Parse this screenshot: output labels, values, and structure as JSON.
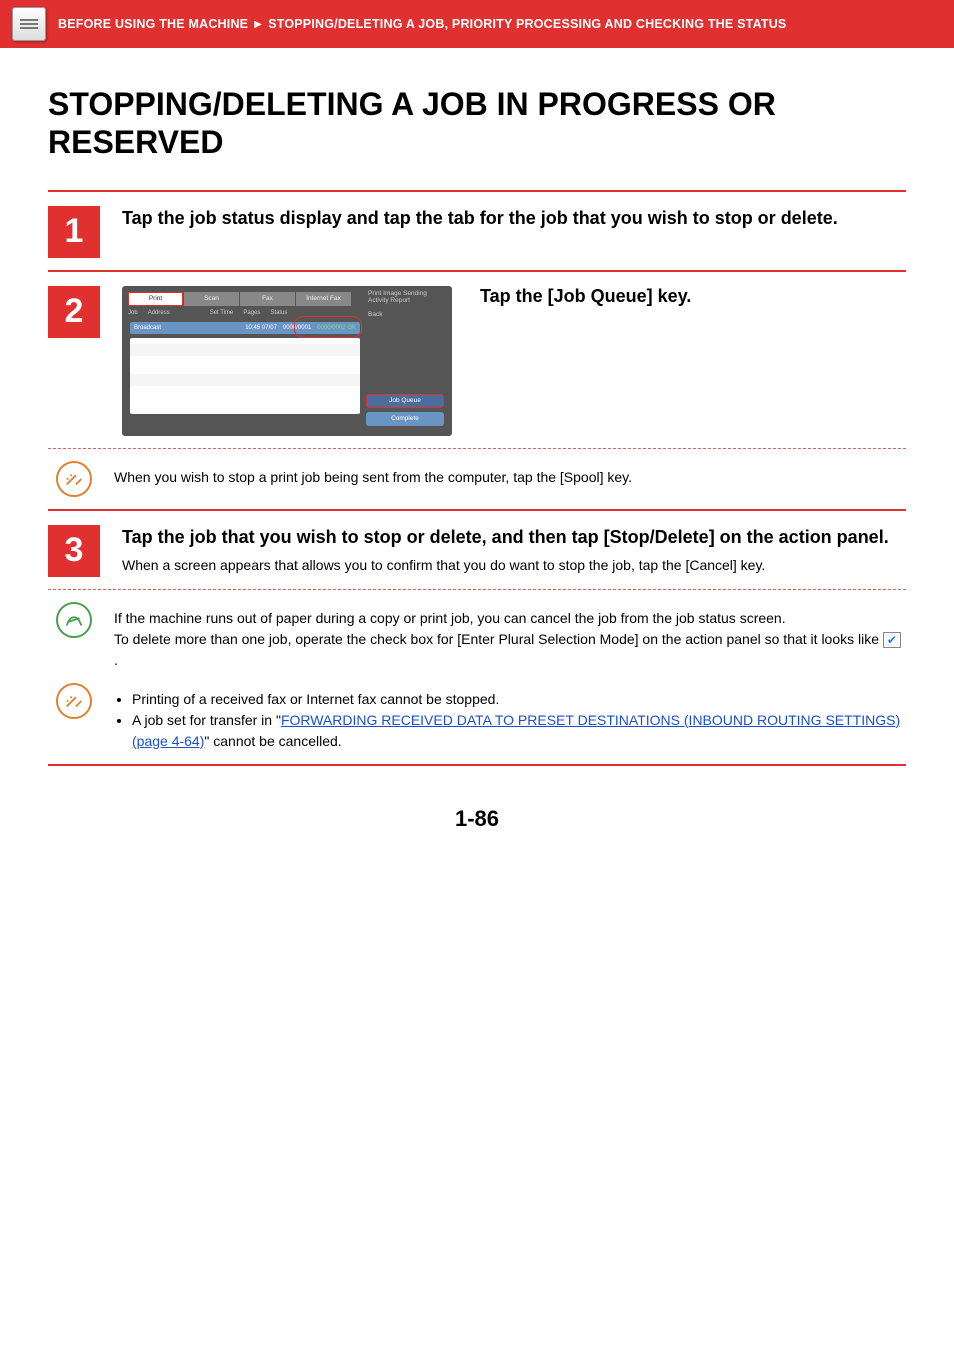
{
  "header": {
    "breadcrumb_a": "BEFORE USING THE MACHINE",
    "arrow": "►",
    "breadcrumb_b": "STOPPING/DELETING A JOB, PRIORITY PROCESSING AND CHECKING THE STATUS"
  },
  "title": "STOPPING/DELETING A JOB IN PROGRESS OR RESERVED",
  "steps": {
    "s1": {
      "num": "1",
      "head": "Tap the job status display and tap the tab for the job that you wish to stop or delete."
    },
    "s2": {
      "num": "2",
      "head": "Tap the [Job Queue] key.",
      "ui": {
        "tab_print": "Print",
        "tab_scan": "Scan",
        "tab_fax": "Fax",
        "tab_ifax": "Internet Fax",
        "title_right": "Print Image Sending Activity Report",
        "back": "Back",
        "col_job": "Job",
        "col_addr": "Address",
        "col_time": "Set Time",
        "col_pages": "Pages",
        "col_status": "Status",
        "row_label": "Broadcast",
        "row_time": "10:45 07/07",
        "row_pages": "0000/0001",
        "row_status": "0000/0002 OK",
        "btn_jq": "Job Queue",
        "btn_cp": "Complete"
      }
    },
    "s3": {
      "num": "3",
      "head": "Tap the job that you wish to stop or delete, and then tap [Stop/Delete] on the action panel.",
      "body": "When a screen appears that allows you to confirm that you do want to stop the job, tap the [Cancel] key."
    }
  },
  "notes": {
    "n1": "When you wish to stop a print job being sent from the computer, tap the [Spool] key.",
    "n2a": "If the machine runs out of paper during a copy or print job, you can cancel the job from the job status screen.",
    "n2b_pre": "To delete more than one job, operate the check box for [Enter Plural Selection Mode] on the action panel so that it looks like ",
    "n2b_post": " .",
    "n3_b1": "Printing of a received fax or Internet fax cannot be stopped.",
    "n3_b2_pre": "A job set for transfer in \"",
    "n3_b2_link": "FORWARDING RECEIVED DATA TO PRESET DESTINATIONS (INBOUND ROUTING SETTINGS) (page 4-64)",
    "n3_b2_post": "\" cannot be cancelled."
  },
  "page_number": "1-86"
}
